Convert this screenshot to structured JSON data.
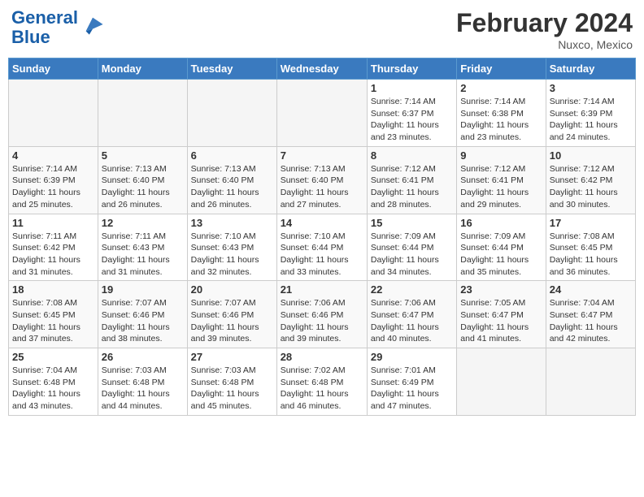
{
  "header": {
    "logo_general": "General",
    "logo_blue": "Blue",
    "month_year": "February 2024",
    "location": "Nuxco, Mexico"
  },
  "days_of_week": [
    "Sunday",
    "Monday",
    "Tuesday",
    "Wednesday",
    "Thursday",
    "Friday",
    "Saturday"
  ],
  "weeks": [
    [
      {
        "day": "",
        "empty": true
      },
      {
        "day": "",
        "empty": true
      },
      {
        "day": "",
        "empty": true
      },
      {
        "day": "",
        "empty": true
      },
      {
        "day": "1",
        "sunrise": "7:14 AM",
        "sunset": "6:37 PM",
        "daylight": "11 hours and 23 minutes."
      },
      {
        "day": "2",
        "sunrise": "7:14 AM",
        "sunset": "6:38 PM",
        "daylight": "11 hours and 23 minutes."
      },
      {
        "day": "3",
        "sunrise": "7:14 AM",
        "sunset": "6:39 PM",
        "daylight": "11 hours and 24 minutes."
      }
    ],
    [
      {
        "day": "4",
        "sunrise": "7:14 AM",
        "sunset": "6:39 PM",
        "daylight": "11 hours and 25 minutes."
      },
      {
        "day": "5",
        "sunrise": "7:13 AM",
        "sunset": "6:40 PM",
        "daylight": "11 hours and 26 minutes."
      },
      {
        "day": "6",
        "sunrise": "7:13 AM",
        "sunset": "6:40 PM",
        "daylight": "11 hours and 26 minutes."
      },
      {
        "day": "7",
        "sunrise": "7:13 AM",
        "sunset": "6:40 PM",
        "daylight": "11 hours and 27 minutes."
      },
      {
        "day": "8",
        "sunrise": "7:12 AM",
        "sunset": "6:41 PM",
        "daylight": "11 hours and 28 minutes."
      },
      {
        "day": "9",
        "sunrise": "7:12 AM",
        "sunset": "6:41 PM",
        "daylight": "11 hours and 29 minutes."
      },
      {
        "day": "10",
        "sunrise": "7:12 AM",
        "sunset": "6:42 PM",
        "daylight": "11 hours and 30 minutes."
      }
    ],
    [
      {
        "day": "11",
        "sunrise": "7:11 AM",
        "sunset": "6:42 PM",
        "daylight": "11 hours and 31 minutes."
      },
      {
        "day": "12",
        "sunrise": "7:11 AM",
        "sunset": "6:43 PM",
        "daylight": "11 hours and 31 minutes."
      },
      {
        "day": "13",
        "sunrise": "7:10 AM",
        "sunset": "6:43 PM",
        "daylight": "11 hours and 32 minutes."
      },
      {
        "day": "14",
        "sunrise": "7:10 AM",
        "sunset": "6:44 PM",
        "daylight": "11 hours and 33 minutes."
      },
      {
        "day": "15",
        "sunrise": "7:09 AM",
        "sunset": "6:44 PM",
        "daylight": "11 hours and 34 minutes."
      },
      {
        "day": "16",
        "sunrise": "7:09 AM",
        "sunset": "6:44 PM",
        "daylight": "11 hours and 35 minutes."
      },
      {
        "day": "17",
        "sunrise": "7:08 AM",
        "sunset": "6:45 PM",
        "daylight": "11 hours and 36 minutes."
      }
    ],
    [
      {
        "day": "18",
        "sunrise": "7:08 AM",
        "sunset": "6:45 PM",
        "daylight": "11 hours and 37 minutes."
      },
      {
        "day": "19",
        "sunrise": "7:07 AM",
        "sunset": "6:46 PM",
        "daylight": "11 hours and 38 minutes."
      },
      {
        "day": "20",
        "sunrise": "7:07 AM",
        "sunset": "6:46 PM",
        "daylight": "11 hours and 39 minutes."
      },
      {
        "day": "21",
        "sunrise": "7:06 AM",
        "sunset": "6:46 PM",
        "daylight": "11 hours and 39 minutes."
      },
      {
        "day": "22",
        "sunrise": "7:06 AM",
        "sunset": "6:47 PM",
        "daylight": "11 hours and 40 minutes."
      },
      {
        "day": "23",
        "sunrise": "7:05 AM",
        "sunset": "6:47 PM",
        "daylight": "11 hours and 41 minutes."
      },
      {
        "day": "24",
        "sunrise": "7:04 AM",
        "sunset": "6:47 PM",
        "daylight": "11 hours and 42 minutes."
      }
    ],
    [
      {
        "day": "25",
        "sunrise": "7:04 AM",
        "sunset": "6:48 PM",
        "daylight": "11 hours and 43 minutes."
      },
      {
        "day": "26",
        "sunrise": "7:03 AM",
        "sunset": "6:48 PM",
        "daylight": "11 hours and 44 minutes."
      },
      {
        "day": "27",
        "sunrise": "7:03 AM",
        "sunset": "6:48 PM",
        "daylight": "11 hours and 45 minutes."
      },
      {
        "day": "28",
        "sunrise": "7:02 AM",
        "sunset": "6:48 PM",
        "daylight": "11 hours and 46 minutes."
      },
      {
        "day": "29",
        "sunrise": "7:01 AM",
        "sunset": "6:49 PM",
        "daylight": "11 hours and 47 minutes."
      },
      {
        "day": "",
        "empty": true
      },
      {
        "day": "",
        "empty": true
      }
    ]
  ],
  "labels": {
    "sunrise": "Sunrise:",
    "sunset": "Sunset:",
    "daylight": "Daylight:"
  }
}
